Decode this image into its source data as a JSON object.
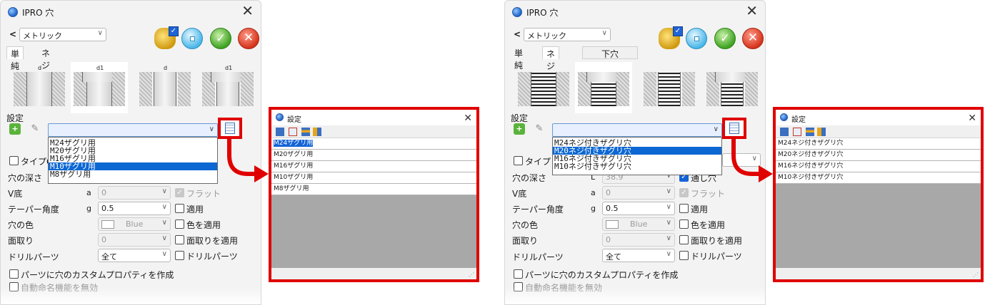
{
  "left": {
    "window": {
      "title": "IPRO 穴"
    },
    "unit_select": {
      "back": "<",
      "value": "メトリック"
    },
    "tabs": {
      "simple": "単純",
      "thread": "ネジ穴"
    },
    "thumbnails": [
      {
        "name": "straight-hole",
        "dims": "d"
      },
      {
        "name": "counterbore-hole",
        "dims": "d1"
      },
      {
        "name": "countersink-hole",
        "dims": "d"
      },
      {
        "name": "counterbore-countersink-hole",
        "dims": "d1"
      }
    ],
    "settings": {
      "label": "設定",
      "items": [
        "M24ザグリ用",
        "M20ザグリ用",
        "M16ザグリ用",
        "M10ザグリ用",
        "M8ザグリ用"
      ],
      "selected_index": 3
    },
    "rows": {
      "type_check": "タイプG",
      "depth": "穴の深さ",
      "v_bottom": {
        "label": "V底",
        "sym": "a",
        "value": "0",
        "check_label": "フラット"
      },
      "taper": {
        "label": "テーパー角度",
        "sym": "g",
        "value": "0.5",
        "check_label": "適用"
      },
      "color": {
        "label": "穴の色",
        "value": "Blue",
        "check_label": "色を適用"
      },
      "chamfer": {
        "label": "面取り",
        "value": "0",
        "check_label": "面取りを適用"
      },
      "drill": {
        "label": "ドリルパーツ",
        "value": "全て",
        "check_label": "ドリルパーツ"
      },
      "custom_props": "パーツに穴のカスタムプロパティを作成",
      "auto_name": "自動命名機能を無効"
    }
  },
  "right": {
    "window": {
      "title": "IPRO 穴"
    },
    "unit_select": {
      "back": "<",
      "value": "メトリック"
    },
    "tabs": {
      "simple": "単純",
      "thread": "ネジ穴",
      "pilot": "下穴"
    },
    "settings": {
      "label": "設定",
      "items": [
        "M24ネジ付きザグリ穴",
        "M20ネジ付きザグリ穴",
        "M16ネジ付きザグリ穴",
        "M10ネジ付きザグリ穴"
      ],
      "selected_index": 1
    },
    "rows": {
      "type_check": "タイプ",
      "depth": {
        "label": "穴の深さ",
        "sym": "L",
        "value": "38.9",
        "check_label": "通し穴"
      },
      "v_bottom": {
        "label": "V底",
        "sym": "a",
        "value": "0",
        "check_label": "フラット"
      },
      "taper": {
        "label": "テーパー角度",
        "sym": "g",
        "value": "0.5",
        "check_label": "適用"
      },
      "color": {
        "label": "穴の色",
        "value": "Blue",
        "check_label": "色を適用"
      },
      "chamfer": {
        "label": "面取り",
        "value": "0",
        "check_label": "面取りを適用"
      },
      "drill": {
        "label": "ドリルパーツ",
        "value": "全て",
        "check_label": "ドリルパーツ"
      },
      "custom_props": "パーツに穴のカスタムプロパティを作成",
      "auto_name": "自動命名機能を無効"
    }
  },
  "popup_left": {
    "title": "設定",
    "items": [
      "M24ザグリ用",
      "M20ザグリ用",
      "M16ザグリ用",
      "M10ザグリ用",
      "M8ザグリ用"
    ]
  },
  "popup_right": {
    "title": "設定",
    "items": [
      "M24ネジ付きザグリ穴",
      "M20ネジ付きザグリ穴",
      "M16ネジ付きザグリ穴",
      "M10ネジ付きザグリ穴"
    ]
  },
  "colors": {
    "highlight": "#e00000",
    "selection": "#0c67d3"
  },
  "icons": {
    "options": "options-gear-check-icon",
    "stop": "stop-icon",
    "ok": "ok-check-icon",
    "cancel": "cancel-x-icon",
    "add": "add-setting-icon",
    "edit": "edit-setting-icon",
    "settings_list": "settings-list-icon"
  }
}
